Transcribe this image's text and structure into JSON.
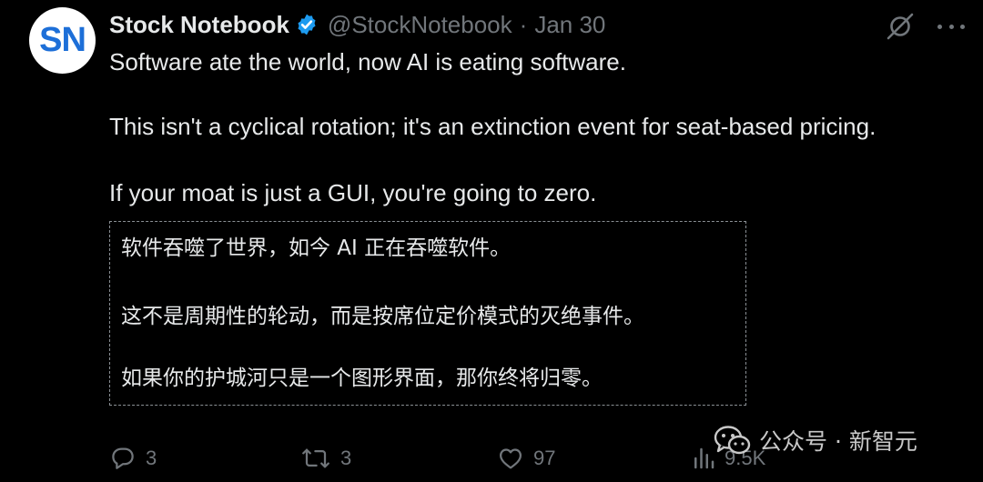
{
  "author": {
    "avatar_initials": "SN",
    "display_name": "Stock Notebook",
    "handle": "@StockNotebook",
    "separator": "·",
    "date": "Jan 30"
  },
  "tweet": {
    "lines": [
      "Software ate the world, now AI is eating software.",
      "This isn't a cyclical rotation; it's an extinction event for seat-based pricing.",
      "If your moat is just a GUI, you're going to zero."
    ]
  },
  "translation": {
    "lines": [
      "软件吞噬了世界，如今 AI 正在吞噬软件。",
      "这不是周期性的轮动，而是按席位定价模式的灭绝事件。",
      "如果你的护城河只是一个图形界面，那你终将归零。"
    ]
  },
  "actions": {
    "replies": "3",
    "reposts": "3",
    "likes": "97",
    "views": "9.5K"
  },
  "watermark": {
    "text": "公众号 · 新智元"
  },
  "icons": {
    "verified": "verified-badge-icon",
    "grok": "grok-icon",
    "more": "more-icon",
    "reply": "reply-icon",
    "repost": "repost-icon",
    "like": "like-icon",
    "views": "views-icon",
    "wechat": "wechat-icon"
  },
  "colors": {
    "background": "#000000",
    "text": "#e7e9ea",
    "secondary": "#71767b",
    "verified": "#1d9bf0",
    "avatar_text": "#1d6fd8"
  }
}
